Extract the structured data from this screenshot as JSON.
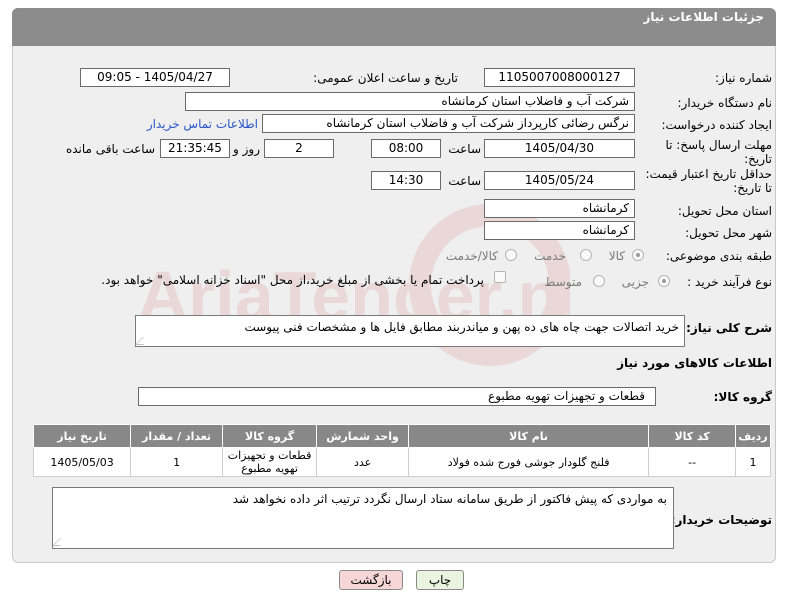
{
  "header": {
    "title": "جزئیات اطلاعات نیاز"
  },
  "form": {
    "need_number": {
      "label": "شماره نیاز:",
      "value": "1105007008000127"
    },
    "announce_datetime": {
      "label": "تاریخ و ساعت اعلان عمومی:",
      "value": "1405/04/27 - 09:05"
    },
    "buyer_org": {
      "label": "نام دستگاه خریدار:",
      "value": "شرکت آب و فاضلاب استان کرمانشاه"
    },
    "requester": {
      "label": "ایجاد کننده درخواست:",
      "value": "نرگس رضائی کارپرداز شرکت آب و فاضلاب استان کرمانشاه",
      "contact_link": "اطلاعات تماس خریدار"
    },
    "reply_deadline": {
      "label_line1": "مهلت ارسال پاسخ: تا",
      "label_line2": "تاریخ:",
      "date": "1405/04/30",
      "time_label": "ساعت",
      "time": "08:00",
      "days": "2",
      "days_label": "روز و",
      "remaining": "21:35:45",
      "remaining_label": "ساعت باقی مانده"
    },
    "price_validity": {
      "label_line1": "حداقل تاریخ اعتبار قیمت:",
      "label_line2": "تا تاریخ:",
      "date": "1405/05/24",
      "time_label": "ساعت",
      "time": "14:30"
    },
    "delivery_province": {
      "label": "استان محل تحویل:",
      "value": "کرمانشاه"
    },
    "delivery_city": {
      "label": "شهر محل تحویل:",
      "value": "کرمانشاه"
    },
    "category": {
      "label": "طبقه بندی موضوعی:",
      "options": [
        "کالا",
        "خدمت",
        "کالا/خدمت"
      ],
      "selected": "کالا"
    },
    "purchase_type": {
      "label": "نوع فرآیند خرید :",
      "options": [
        "جزیی",
        "متوسط"
      ],
      "selected": "جزیی",
      "payment_note": "پرداخت تمام یا بخشی از مبلغ خرید،از محل \"اسناد خزانه اسلامی\" خواهد بود."
    }
  },
  "description": {
    "label": "شرح کلی نیاز:",
    "value": "خرید اتصالات جهت چاه های ده پهن و میاندربند مطابق فایل ها و مشخصات فنی پیوست"
  },
  "goods_info": {
    "title": "اطلاعات کالاهای مورد نیاز"
  },
  "goods_group": {
    "label": "گروه کالا:",
    "value": "قطعات و تجهیزات تهویه مطبوع"
  },
  "table": {
    "headers": [
      "ردیف",
      "کد کالا",
      "نام کالا",
      "واحد شمارش",
      "گروه کالا",
      "تعداد / مقدار",
      "تاریخ نیاز"
    ],
    "rows": [
      [
        "1",
        "--",
        "فلنج گلودار جوشی فورج شده فولاد",
        "عدد",
        "قطعات و تجهیزات تهویه مطبوع",
        "1",
        "1405/05/03"
      ]
    ]
  },
  "buyer_notes": {
    "label": "توضیحات خریدار:",
    "value": "به مواردی که پیش فاکتور از طریق سامانه ستاد ارسال نگردد ترتیب اثر داده نخواهد شد"
  },
  "buttons": {
    "print": "چاپ",
    "back": "بازگشت"
  },
  "watermark": {
    "text": "AriaTender.net"
  },
  "colors": {
    "header": "#8c8c8c",
    "panel": "#efefef",
    "link": "#2a55c6",
    "back_button": "#f6d6d6",
    "print_button": "#e9f4e1"
  }
}
